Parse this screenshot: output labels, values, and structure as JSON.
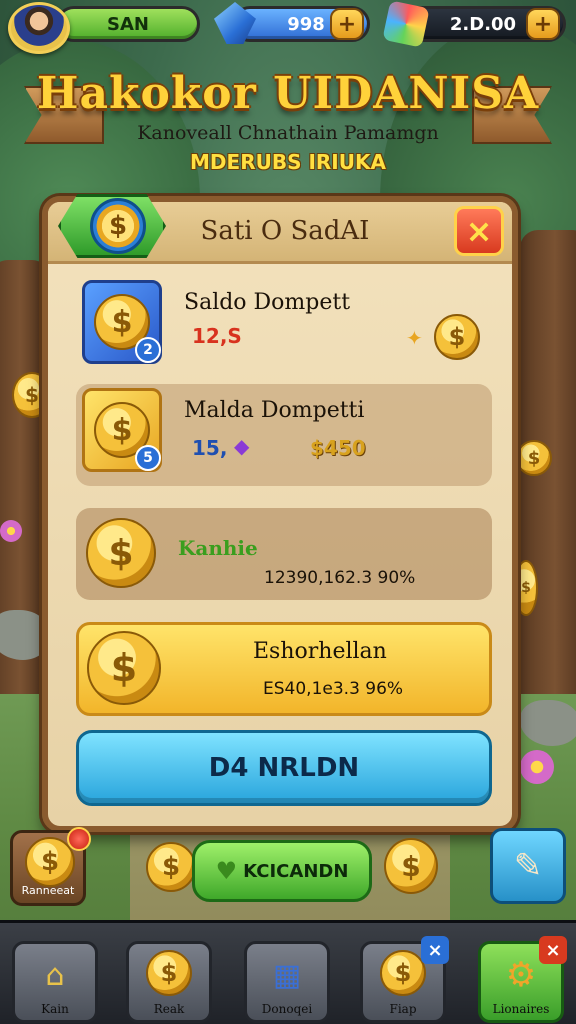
{
  "topbar": {
    "player_name": "SAN",
    "gems": "998",
    "coins": "2.D.00",
    "plus_label": "+"
  },
  "banner": {
    "title": "Hakokor UIDANISA",
    "subtitle": "Kanoveall Chnathain Pamamgn",
    "subtitle2": "MDERUBS IRIUKA"
  },
  "panel": {
    "title": "Sati O SadAI",
    "close_label": "×",
    "rows": [
      {
        "name": "Saldo Dompett",
        "value": "12,S",
        "badge": "2"
      },
      {
        "name": "Malda Dompetti",
        "value": "15,",
        "amount": "$450",
        "badge": "5"
      },
      {
        "name": "Kanhie",
        "amount": "12390,162.3 90%"
      },
      {
        "name": "Eshorhellan",
        "amount": "ES40,1e3.3 96%"
      }
    ],
    "main_button": "D4 NRLDN"
  },
  "actions": {
    "left_label": "Ranneeat",
    "center_label": "KCICANDN"
  },
  "nav": [
    {
      "label": "Kain",
      "icon": "home-icon"
    },
    {
      "label": "Reak",
      "icon": "coin-icon"
    },
    {
      "label": "Donoqei",
      "icon": "scroll-icon"
    },
    {
      "label": "Fiap",
      "icon": "coin-icon",
      "badge": "×"
    },
    {
      "label": "Lionaires",
      "icon": "gear-icon",
      "badge": "×"
    }
  ],
  "colors": {
    "accent_gold": "#ffd23a",
    "panel_bg": "#f3e2bd",
    "main_button": "#28a4dc",
    "close_button": "#d83a1f"
  }
}
